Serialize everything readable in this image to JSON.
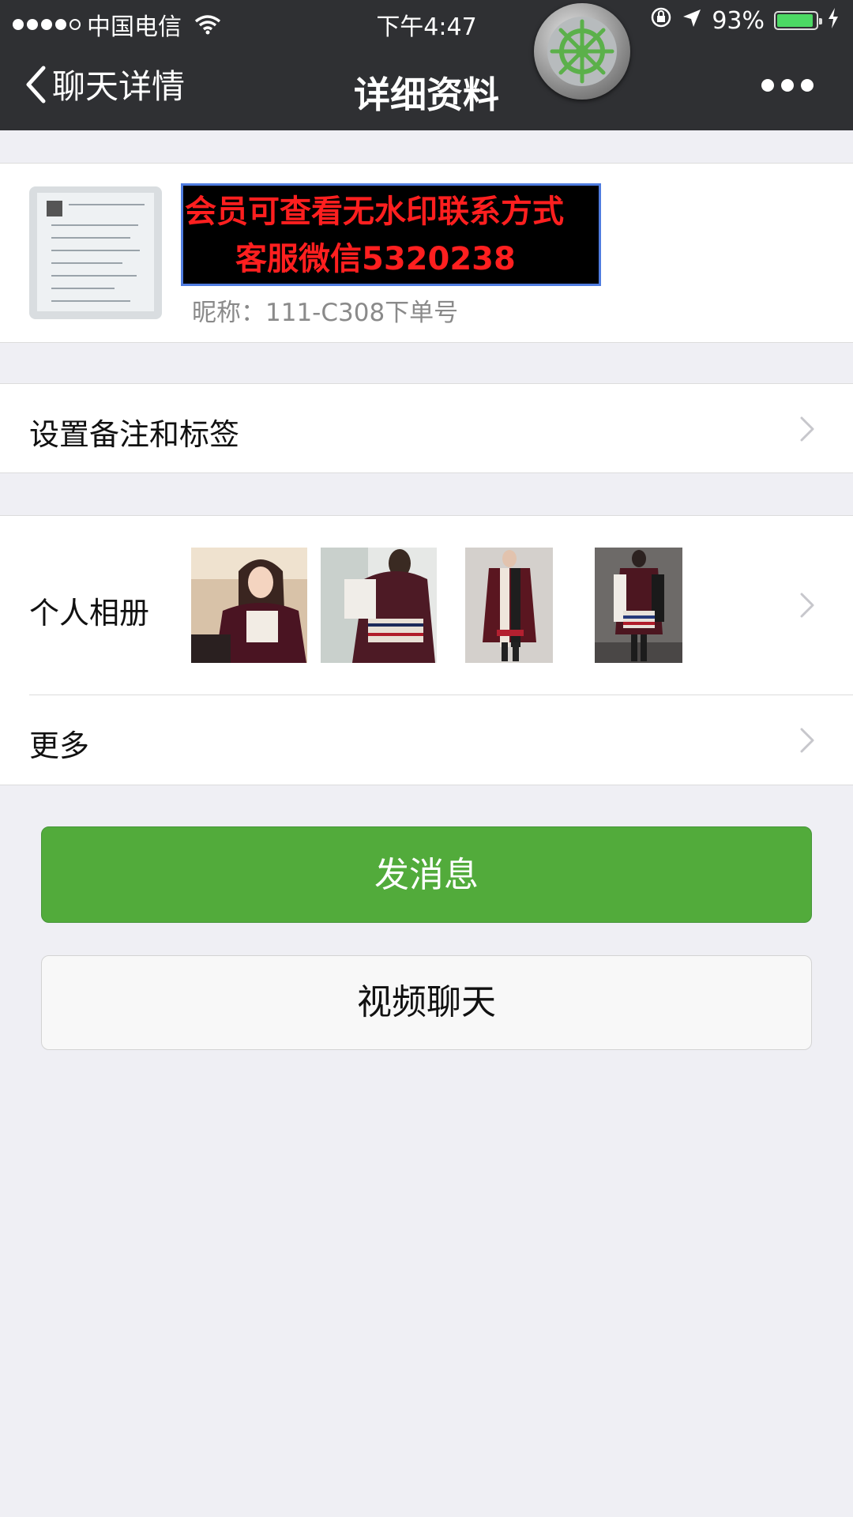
{
  "status_bar": {
    "carrier": "中国电信",
    "time": "下午4:47",
    "battery": "93%",
    "battery_level": 0.93,
    "battery_color": "#4cd964"
  },
  "nav": {
    "back_label": "聊天详情",
    "title": "详细资料",
    "more_icon": "ellipsis-icon",
    "overlay_icon": "ship-wheel-icon"
  },
  "profile": {
    "banner_line1": "会员可查看无水印联系方式",
    "banner_line2": "客服微信5320238",
    "nickname": "昵称：111-C308下单号"
  },
  "list": {
    "remark_tags": "设置备注和标签",
    "album": "个人相册",
    "more": "更多"
  },
  "buttons": {
    "send_message": "发消息",
    "video_chat": "视频聊天"
  },
  "colors": {
    "nav_bg": "#2f3033",
    "primary_green": "#52ab3b",
    "banner_text": "#ff1f1f",
    "page_bg": "#efeff4"
  }
}
